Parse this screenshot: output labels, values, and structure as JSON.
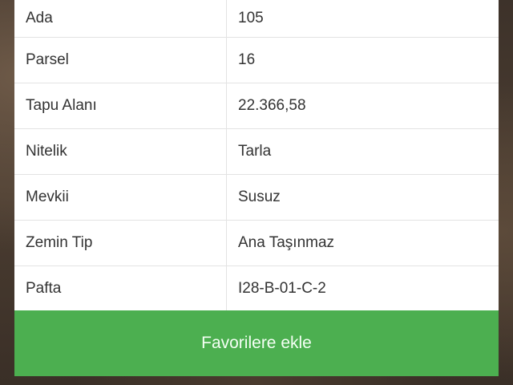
{
  "parcel_info": {
    "rows": [
      {
        "key": "Ada",
        "value": "105"
      },
      {
        "key": "Parsel",
        "value": "16"
      },
      {
        "key": "Tapu Alanı",
        "value": "22.366,58"
      },
      {
        "key": "Nitelik",
        "value": "Tarla"
      },
      {
        "key": "Mevkii",
        "value": "Susuz"
      },
      {
        "key": "Zemin Tip",
        "value": "Ana Taşınmaz"
      },
      {
        "key": "Pafta",
        "value": "I28-B-01-C-2"
      }
    ]
  },
  "actions": {
    "favorite_label": "Favorilere ekle"
  },
  "colors": {
    "accent": "#4caf50"
  }
}
